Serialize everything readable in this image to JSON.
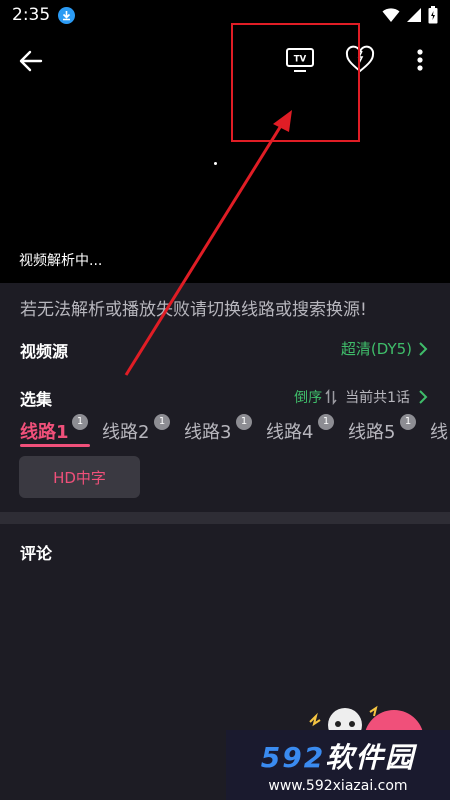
{
  "status_bar": {
    "time": "2:35"
  },
  "player": {
    "parse_status": "视频解析中..."
  },
  "notice": "若无法解析或播放失败请切换线路或搜索换源!",
  "source": {
    "label": "视频源",
    "value": "超清(DY5)"
  },
  "episodes": {
    "label": "选集",
    "order_label": "倒序",
    "count_label": "当前共1话",
    "lines": [
      {
        "label": "线路1",
        "badge": "1"
      },
      {
        "label": "线路2",
        "badge": "1"
      },
      {
        "label": "线路3",
        "badge": "1"
      },
      {
        "label": "线路4",
        "badge": "1"
      },
      {
        "label": "线路5",
        "badge": "1"
      },
      {
        "label": "线",
        "badge": ""
      }
    ],
    "quality": "HD中字"
  },
  "comments": {
    "label": "评论"
  },
  "watermark": {
    "logo_num": "592",
    "logo_cn": "软件园",
    "url": "www.592xiazai.com"
  },
  "colors": {
    "accent": "#f0507a",
    "green": "#3fbd6a",
    "annotation_red": "#e01d25"
  }
}
